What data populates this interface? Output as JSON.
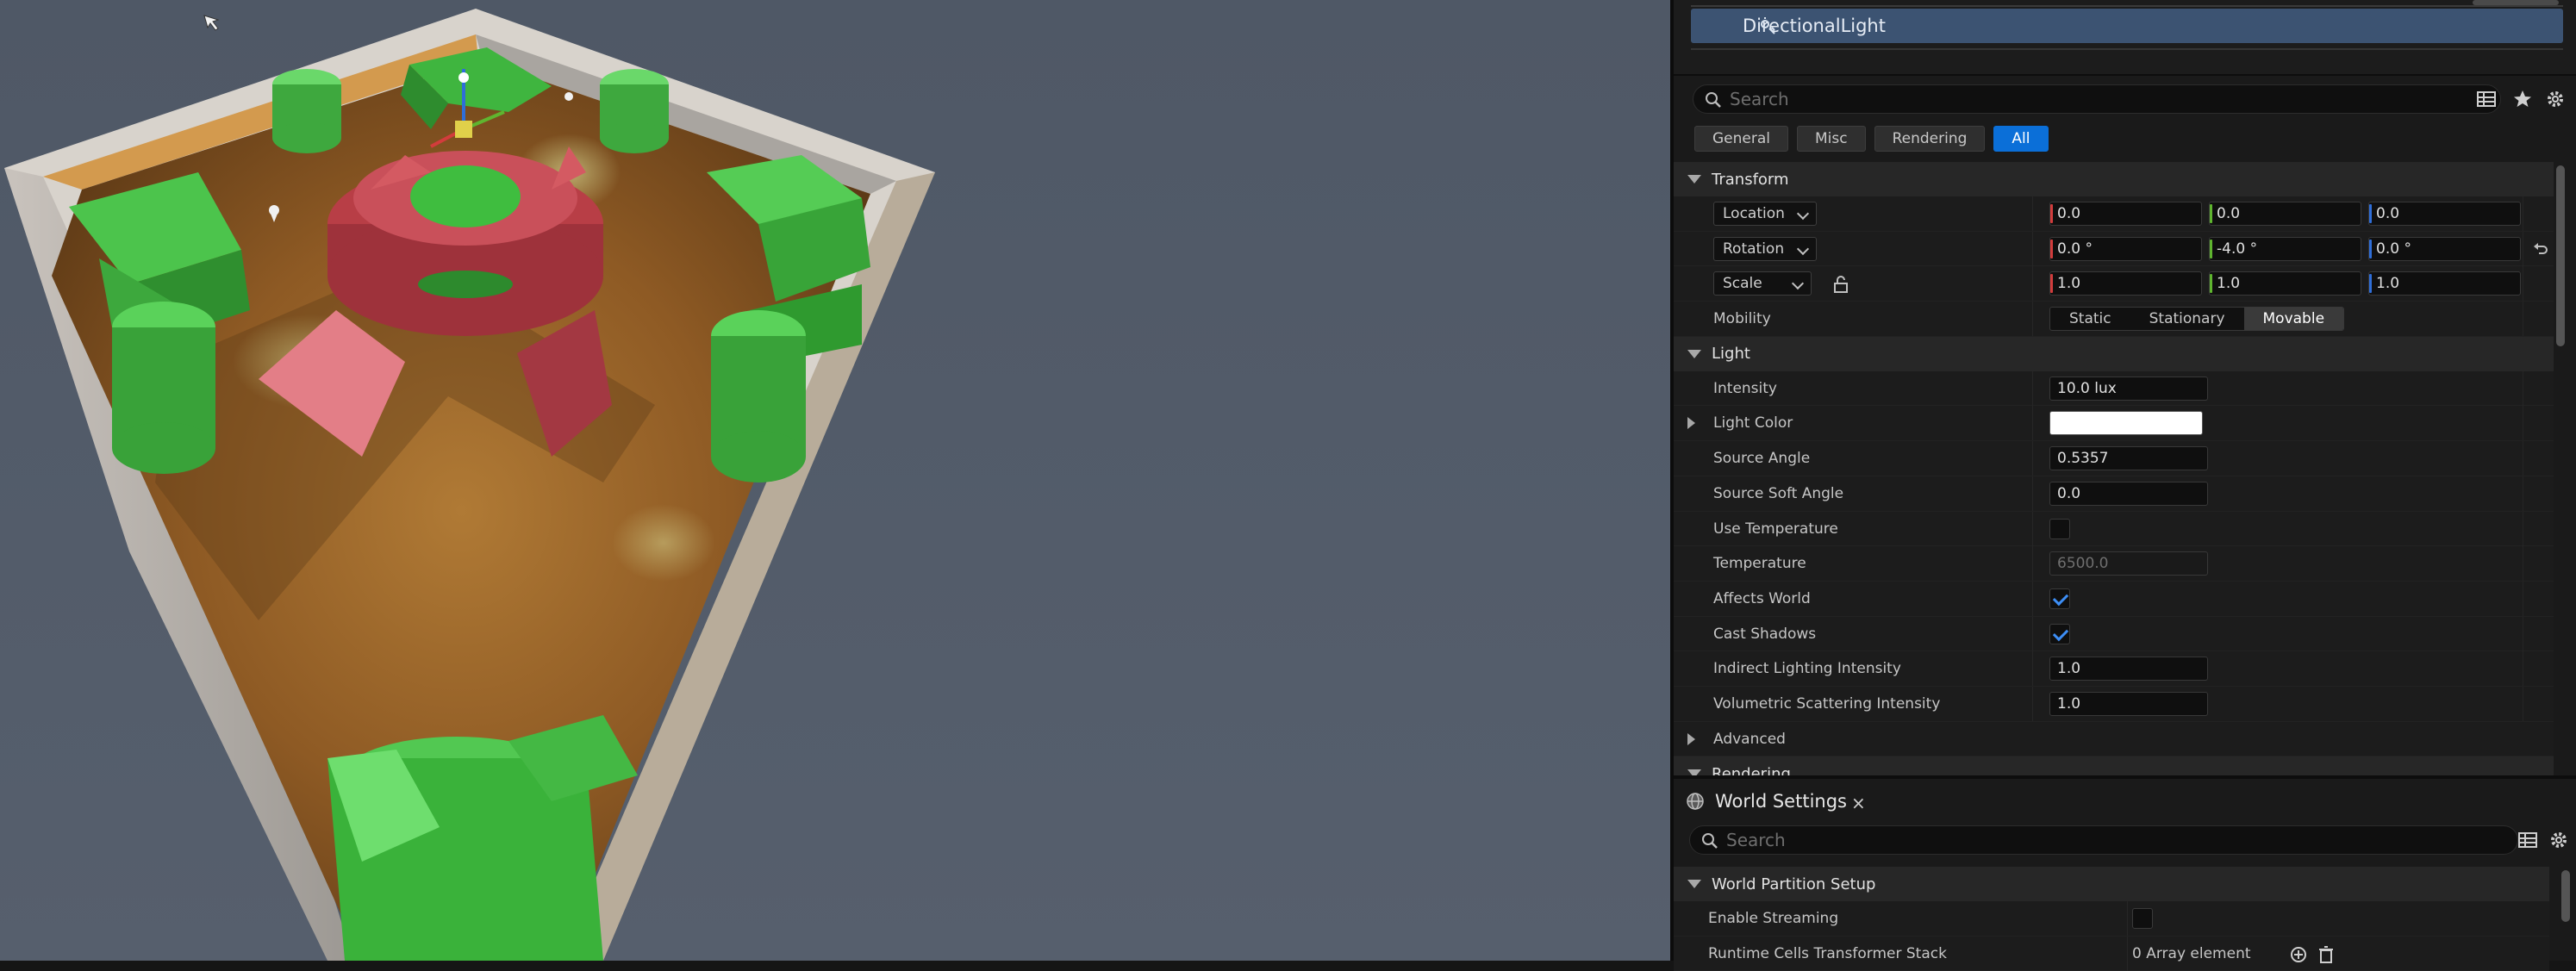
{
  "outliner": {
    "selected_item": "DirectionalLight"
  },
  "details": {
    "search_placeholder": "Search",
    "filters": [
      "General",
      "Misc",
      "Rendering",
      "All"
    ],
    "active_filter": "All",
    "transform": {
      "header": "Transform",
      "location": {
        "label": "Location",
        "x": "0.0",
        "y": "0.0",
        "z": "0.0"
      },
      "rotation": {
        "label": "Rotation",
        "x": "0.0 °",
        "y": "-4.0 °",
        "z": "0.0 °"
      },
      "scale": {
        "label": "Scale",
        "x": "1.0",
        "y": "1.0",
        "z": "1.0"
      },
      "mobility_label": "Mobility",
      "mobility_options": [
        "Static",
        "Stationary",
        "Movable"
      ],
      "mobility_selected": "Movable"
    },
    "light": {
      "header": "Light",
      "intensity_label": "Intensity",
      "intensity": "10.0 lux",
      "light_color_label": "Light Color",
      "light_color": "#ffffff",
      "source_angle_label": "Source Angle",
      "source_angle": "0.5357",
      "source_soft_angle_label": "Source Soft Angle",
      "source_soft_angle": "0.0",
      "use_temperature_label": "Use Temperature",
      "use_temperature": false,
      "temperature_label": "Temperature",
      "temperature": "6500.0",
      "affects_world_label": "Affects World",
      "affects_world": true,
      "cast_shadows_label": "Cast Shadows",
      "cast_shadows": true,
      "indirect_lighting_label": "Indirect Lighting Intensity",
      "indirect_lighting": "1.0",
      "volumetric_scattering_label": "Volumetric Scattering Intensity",
      "volumetric_scattering": "1.0",
      "advanced_label": "Advanced"
    },
    "rendering_header": "Rendering"
  },
  "world_settings": {
    "tab_title": "World Settings",
    "close_glyph": "×",
    "search_placeholder": "Search",
    "section": "World Partition Setup",
    "enable_streaming_label": "Enable Streaming",
    "enable_streaming": false,
    "runtime_cells_label": "Runtime Cells Transformer Stack",
    "runtime_cells_value": "0 Array element"
  },
  "colors": {
    "accent": "#0b6fd8",
    "selection": "#3c5372",
    "axis_x": "#d23c3c",
    "axis_y": "#5fb52f",
    "axis_z": "#2f6ed8",
    "check": "#3d8ef5"
  }
}
